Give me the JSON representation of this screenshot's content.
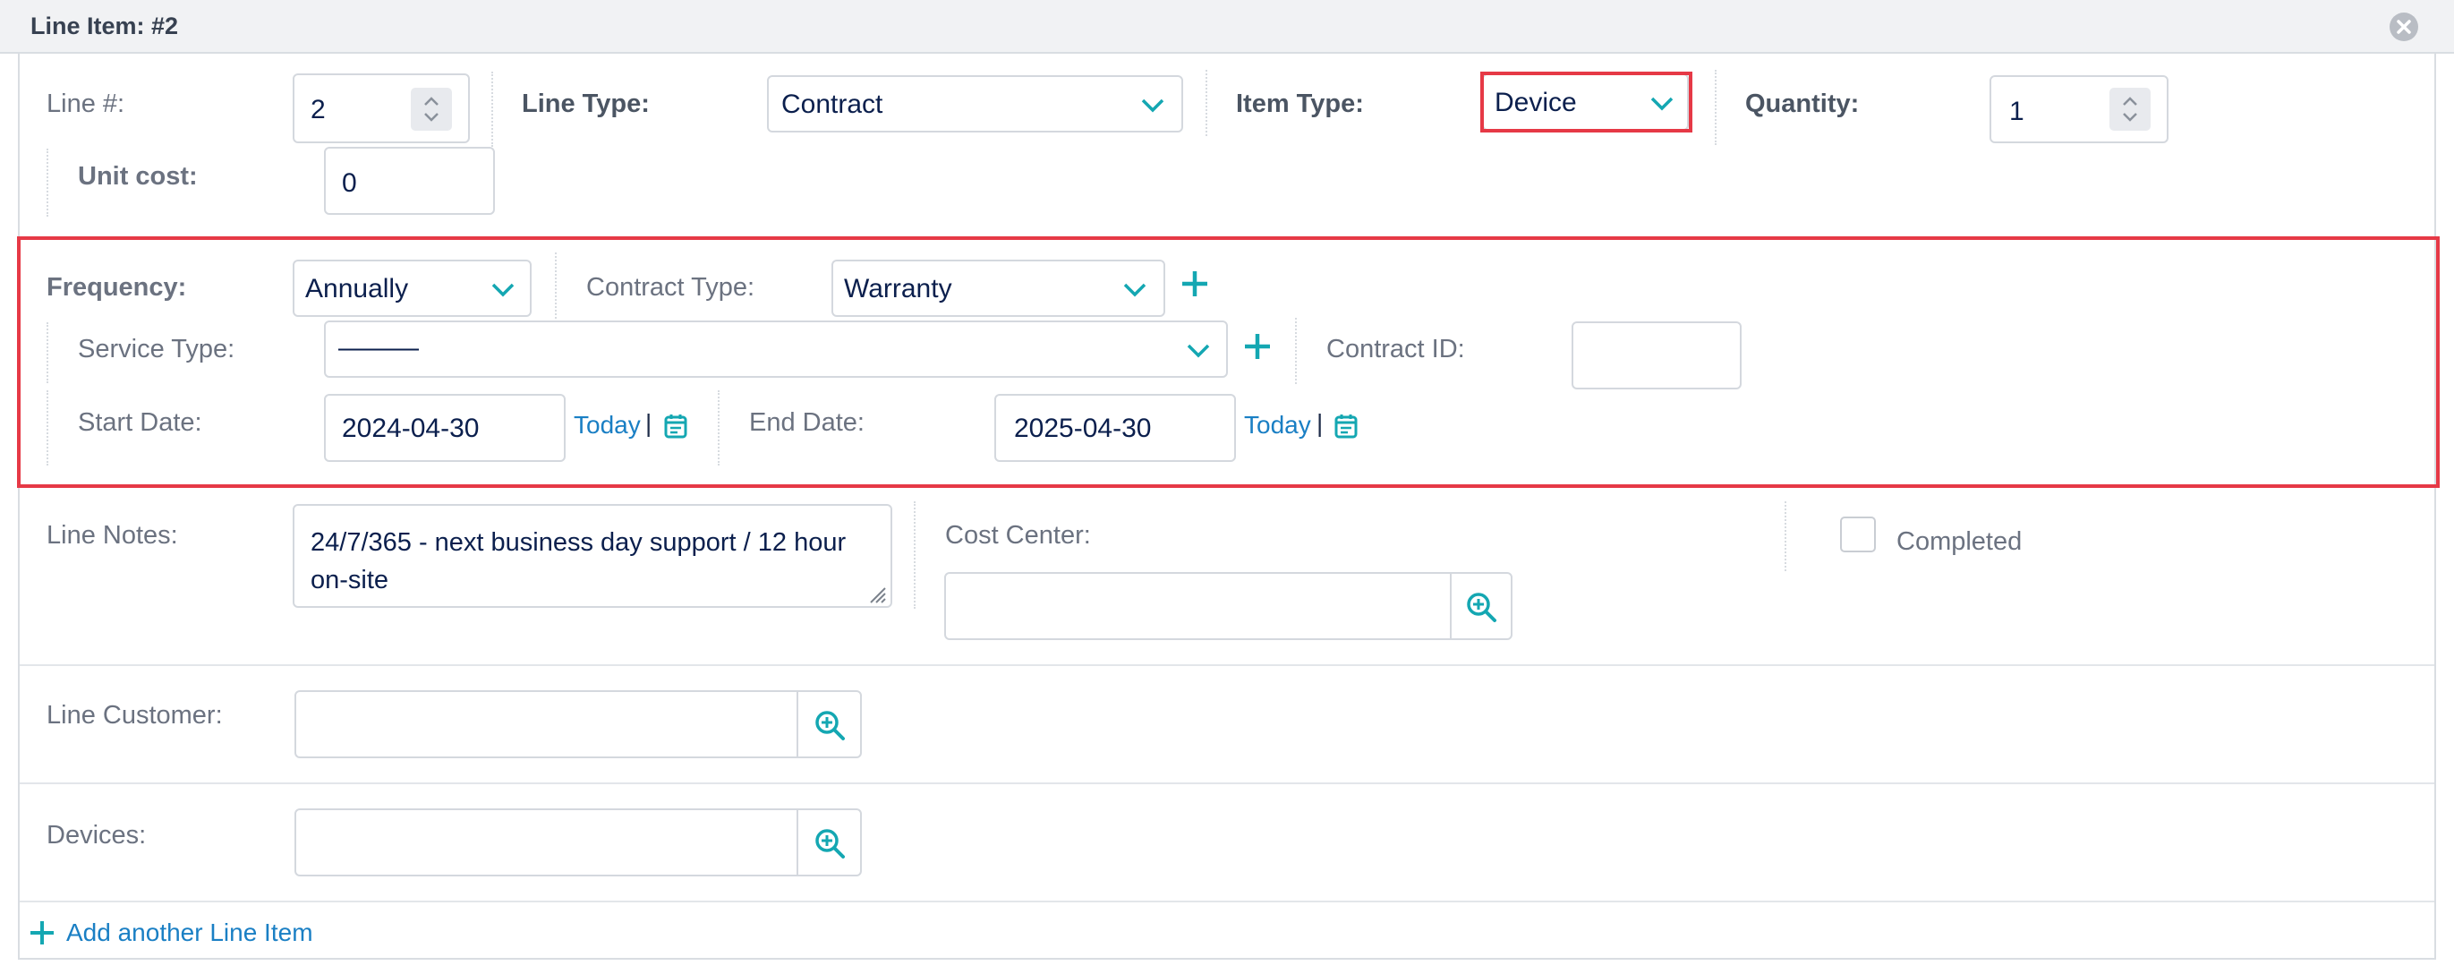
{
  "header": {
    "title": "Line Item: #2"
  },
  "row1": {
    "line_num_label": "Line #:",
    "line_num_value": "2",
    "line_type_label": "Line Type:",
    "line_type_value": "Contract",
    "item_type_label": "Item Type:",
    "item_type_value": "Device",
    "quantity_label": "Quantity:",
    "quantity_value": "1",
    "unit_cost_label": "Unit cost:",
    "unit_cost_value": "0"
  },
  "contract": {
    "frequency_label": "Frequency:",
    "frequency_value": "Annually",
    "contract_type_label": "Contract Type:",
    "contract_type_value": "Warranty",
    "service_type_label": "Service Type:",
    "service_type_value": "———",
    "contract_id_label": "Contract ID:",
    "contract_id_value": "",
    "start_date_label": "Start Date:",
    "start_date_value": "2024-04-30",
    "end_date_label": "End Date:",
    "end_date_value": "2025-04-30",
    "today_label": "Today",
    "separator": "|"
  },
  "notes": {
    "line_notes_label": "Line Notes:",
    "line_notes_value": "24/7/365 - next business day support / 12 hour on-site",
    "cost_center_label": "Cost Center:",
    "cost_center_value": "",
    "completed_label": "Completed"
  },
  "customer": {
    "label": "Line Customer:",
    "value": ""
  },
  "devices": {
    "label": "Devices:",
    "value": ""
  },
  "footer": {
    "add_label": "Add another Line Item"
  },
  "colors": {
    "accent": "#14a7b2",
    "highlight": "#e63946",
    "link": "#1a7fc4"
  }
}
